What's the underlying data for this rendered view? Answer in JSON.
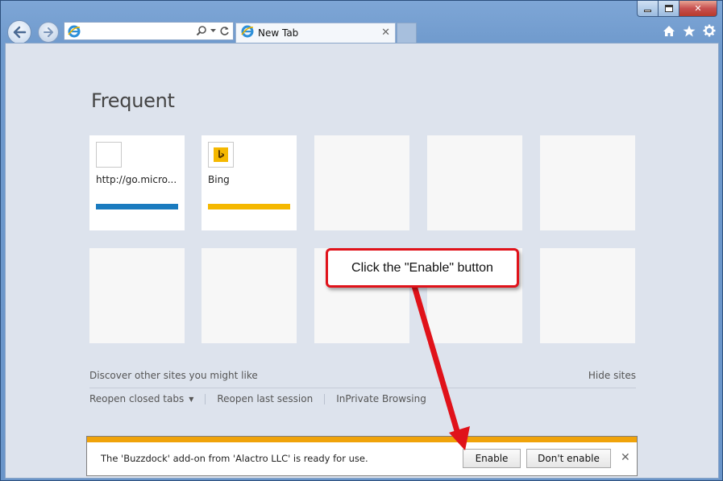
{
  "browser": {
    "address_value": "",
    "tab_title": "New Tab",
    "caption": {
      "minimize": "minimize",
      "maximize": "maximize",
      "close": "close"
    }
  },
  "newtab_page": {
    "heading": "Frequent",
    "tiles": [
      {
        "label": "http://go.micro...",
        "accent": "#1a7bbf"
      },
      {
        "label": "Bing",
        "accent": "#f5b800"
      }
    ],
    "discover_label": "Discover other sites you might like",
    "hide_sites_label": "Hide sites",
    "reopen_closed_tabs": "Reopen closed tabs",
    "reopen_last_session": "Reopen last session",
    "inprivate": "InPrivate Browsing"
  },
  "notification": {
    "message": "The 'Buzzdock' add-on from 'Alactro LLC' is ready for use.",
    "enable_label": "Enable",
    "dont_enable_label": "Don't enable",
    "accent": "#f0a30a"
  },
  "callout": {
    "text": "Click the \"Enable\" button",
    "color": "#e0121a"
  }
}
